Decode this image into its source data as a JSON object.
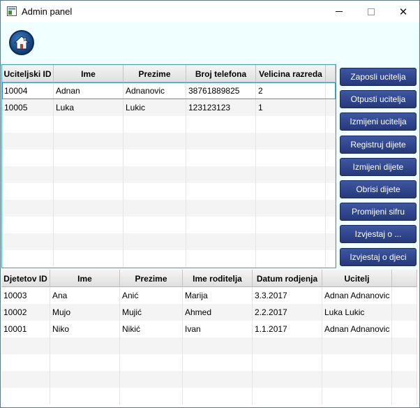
{
  "window": {
    "title": "Admin panel",
    "minimize_glyph": "",
    "maximize_glyph": "",
    "close_glyph": "✕"
  },
  "home": {
    "icon": "home-icon"
  },
  "teachers_table": {
    "columns": [
      "Uciteljski ID",
      "Ime",
      "Prezime",
      "Broj telefona",
      "Velicina razreda"
    ],
    "rows": [
      [
        "10004",
        "Adnan",
        "Adnanovic",
        "38761889825",
        "2"
      ],
      [
        "10005",
        "Luka",
        "Lukic",
        "123123123",
        "1"
      ]
    ],
    "selected_row": 0
  },
  "actions": [
    "Zaposli ucitelja",
    "Otpusti ucitelja",
    "Izmijeni ucitelja",
    "Registruj dijete",
    "Izmijeni dijete",
    "Obrisi dijete",
    "Promijeni sifru",
    "Izvjestaj o ...",
    "Izvjestaj o djeci"
  ],
  "children_table": {
    "columns": [
      "Djetetov ID",
      "Ime",
      "Prezime",
      "Ime roditelja",
      "Datum rodjenja",
      "Ucitelj"
    ],
    "rows": [
      [
        "10003",
        "Ana",
        "Anić",
        "Marija",
        "3.3.2017",
        "Adnan Adnanovic"
      ],
      [
        "10002",
        "Mujo",
        "Mujić",
        "Ahmed",
        "2.2.2017",
        "Luka Lukic"
      ],
      [
        "10001",
        "Niko",
        "Nikić",
        "Ivan",
        "1.1.2017",
        "Adnan Adnanovic"
      ]
    ]
  }
}
